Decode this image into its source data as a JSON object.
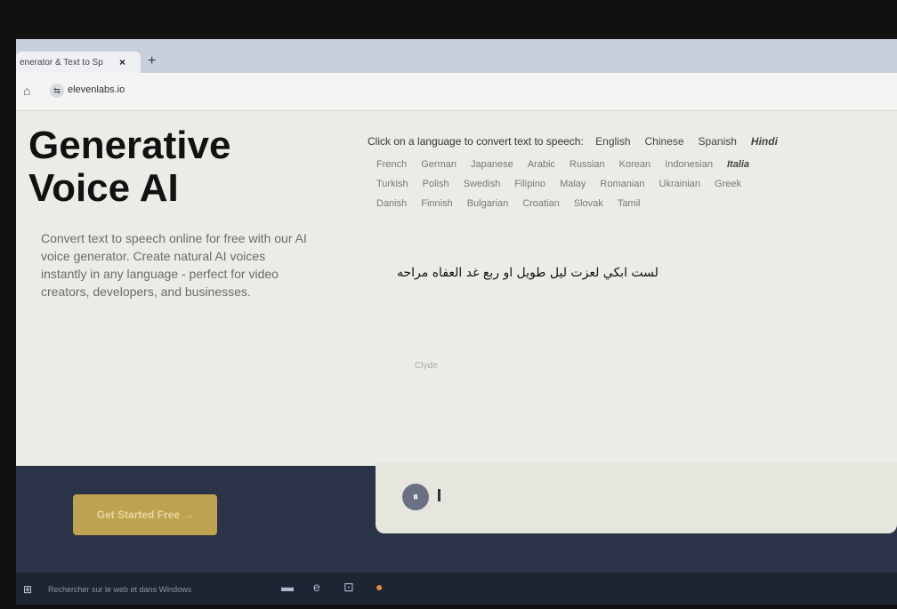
{
  "browser": {
    "tab_title": "enerator & Text to Sp",
    "tab_close": "×",
    "new_tab": "+",
    "url": "elevenlabs.io"
  },
  "hero": {
    "title": "Generative Voice AI",
    "subtitle": "Convert text to speech online for free with our AI voice generator. Create natural AI voices instantly in any language - perfect for video creators, developers, and businesses."
  },
  "languages": {
    "prompt": "Click on a language to convert text to speech:",
    "row1": [
      "English",
      "Chinese",
      "Spanish",
      "Hindi"
    ],
    "row2": [
      "French",
      "German",
      "Japanese",
      "Arabic",
      "Russian",
      "Korean",
      "Indonesian",
      "Italia"
    ],
    "row3": [
      "Turkish",
      "Polish",
      "Swedish",
      "Filipino",
      "Malay",
      "Romanian",
      "Ukrainian",
      "Greek"
    ],
    "row4": [
      "Danish",
      "Finnish",
      "Bulgarian",
      "Croatian",
      "Slovak",
      "Tamil"
    ]
  },
  "editor": {
    "text": "لست ابكي لعزت ليل طويل او ربع غد العفاه مراحه",
    "voice_label": "Clyde"
  },
  "cta": {
    "label": "Get Started Free →"
  },
  "taskbar": {
    "search_placeholder": "Rechercher sur le web et dans Windows"
  },
  "icons": {
    "home": "⌂",
    "site": "⇆",
    "play": "⏸",
    "windows": "⊞",
    "file_explorer": "▬",
    "edge": "e",
    "store": "⊡",
    "chrome": "●"
  }
}
